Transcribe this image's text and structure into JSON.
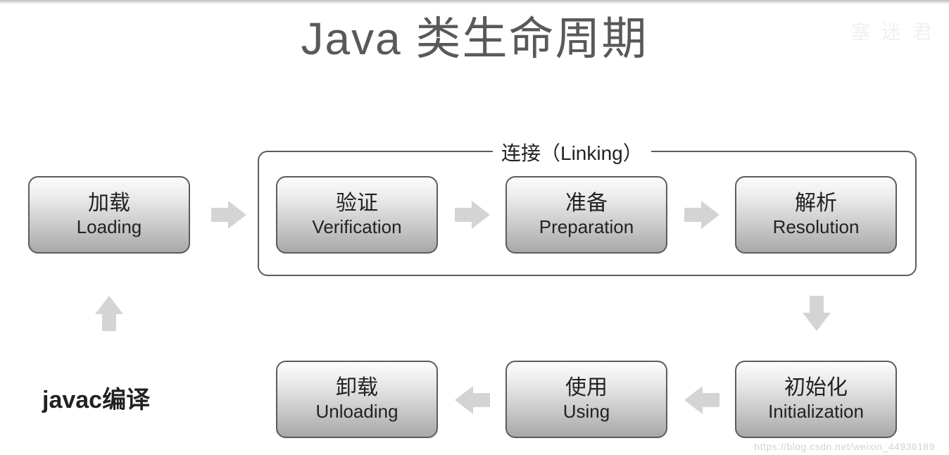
{
  "title": "Java 类生命周期",
  "linking_label": "连接（Linking）",
  "javac_label": "javac编译",
  "watermark": "https://blog.csdn.net/weixin_44936189",
  "wm_top": "塞 迷 君",
  "nodes": {
    "loading": {
      "cn": "加载",
      "en": "Loading"
    },
    "verification": {
      "cn": "验证",
      "en": "Verification"
    },
    "preparation": {
      "cn": "准备",
      "en": "Preparation"
    },
    "resolution": {
      "cn": "解析",
      "en": "Resolution"
    },
    "initialization": {
      "cn": "初始化",
      "en": "Initialization"
    },
    "using": {
      "cn": "使用",
      "en": "Using"
    },
    "unloading": {
      "cn": "卸载",
      "en": "Unloading"
    }
  }
}
